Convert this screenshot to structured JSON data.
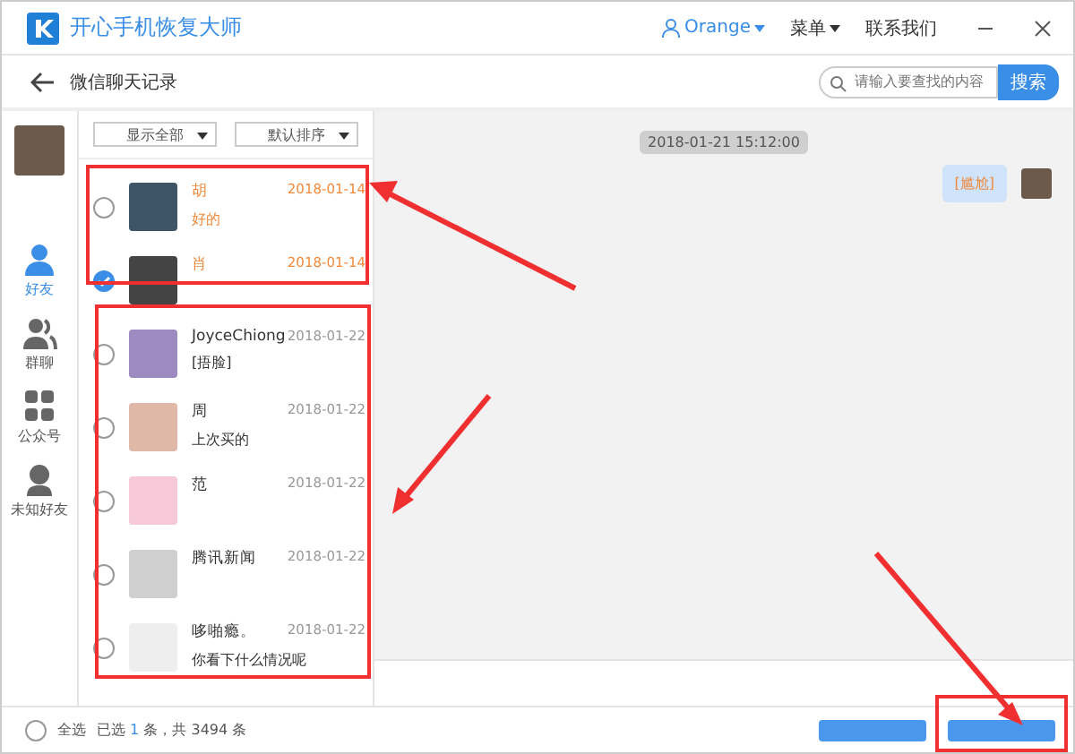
{
  "app": {
    "title": "开心手机恢复大师",
    "user": "Orange",
    "menu": "菜单",
    "contact": "联系我们"
  },
  "header": {
    "title": "微信聊天记录",
    "search": {
      "placeholder": "请输入要查找的内容",
      "button": "搜索"
    }
  },
  "nav": [
    {
      "label": "好友",
      "selected": true,
      "kind": "person"
    },
    {
      "label": "群聊",
      "selected": false,
      "kind": "group"
    },
    {
      "label": "公众号",
      "selected": false,
      "kind": "grid"
    },
    {
      "label": "未知好友",
      "selected": false,
      "kind": "unknown"
    }
  ],
  "filters": [
    "显示全部",
    "默认排序"
  ],
  "contacts": [
    {
      "name": "胡",
      "date": "2018-01-14",
      "preview": "好的",
      "deleted": true,
      "checked": false
    },
    {
      "name": "肖",
      "date": "2018-01-14",
      "deleted": true,
      "checked": true
    },
    {
      "name": "JoyceChiong",
      "date": "2018-01-22",
      "preview": "[捂脸]",
      "deleted": false,
      "checked": false
    },
    {
      "name": "周",
      "date": "2018-01-22",
      "preview": "上次买的",
      "deleted": false,
      "checked": false
    },
    {
      "name": "范",
      "date": "2018-01-22",
      "deleted": false,
      "checked": false
    },
    {
      "name": "腾讯新闻",
      "date": "2018-01-22",
      "deleted": false,
      "checked": false
    },
    {
      "name": "哆啪瘾。",
      "date": "2018-01-22",
      "preview": "你看下什么情况呢",
      "deleted": false,
      "checked": false
    }
  ],
  "chat": {
    "timestamp": "2018-01-21 15:12:00",
    "messages": [
      {
        "text": "[尴尬]"
      }
    ]
  },
  "footer": {
    "select_all": {
      "label": "全选",
      "checked": false
    },
    "selected_prefix": "已选",
    "selected_count": "1",
    "summary": "条，共 3494 条"
  }
}
